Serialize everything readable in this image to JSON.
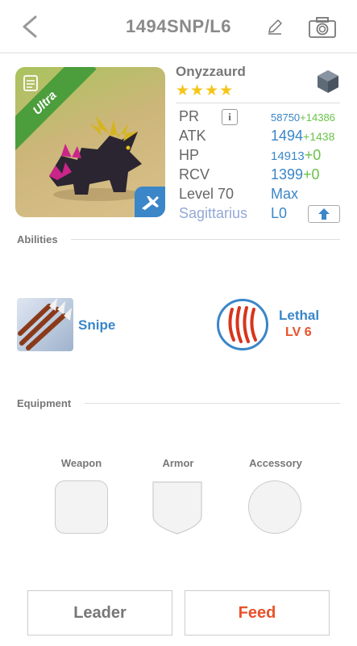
{
  "header": {
    "title": "1494SNP/L6",
    "back_icon": "chevron-left-icon",
    "edit_icon": "pencil-icon",
    "camera_icon": "camera-icon"
  },
  "creature": {
    "rarity": "Ultra",
    "name": "Onyzzaurd",
    "stars": "★★★★",
    "star_count": 4,
    "element_icon": "stone-element-icon",
    "class_icon": "airplane-icon"
  },
  "stats": {
    "pr": {
      "label": "PR",
      "value": "58750",
      "gain": "+14386"
    },
    "atk": {
      "label": "ATK",
      "value": "1494",
      "gain": "+1438"
    },
    "hp": {
      "label": "HP",
      "value": "14913",
      "gain": "+0"
    },
    "rcv": {
      "label": "RCV",
      "value": "1399",
      "gain": "+0"
    },
    "level": {
      "label": "Level 70",
      "value": "Max"
    },
    "sign": {
      "label": "Sagittarius",
      "value": "L0"
    }
  },
  "abilities": {
    "section_label": "Abilities",
    "ability_name": "Snipe",
    "leader_name": "Lethal",
    "leader_level": "LV 6"
  },
  "equipment": {
    "section_label": "Equipment",
    "weapon_label": "Weapon",
    "armor_label": "Armor",
    "accessory_label": "Accessory"
  },
  "actions": {
    "leader_label": "Leader",
    "feed_label": "Feed"
  },
  "colors": {
    "accent_blue": "#3a86c8",
    "gain_green": "#6ac24a",
    "feed_orange": "#e8522a",
    "star_gold": "#f5c518",
    "ultra_green": "#4c9d3c"
  }
}
